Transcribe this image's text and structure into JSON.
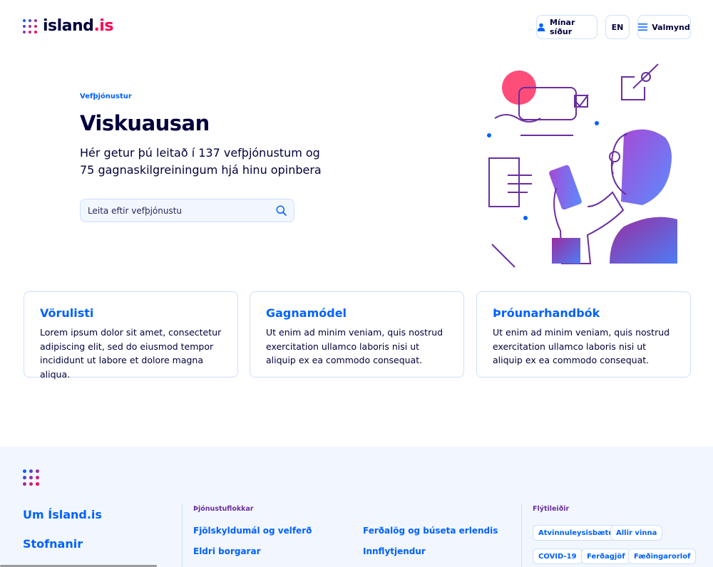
{
  "header": {
    "logo_text": "island",
    "logo_suffix": ".is",
    "my_pages_label": "Mínar síður",
    "lang_label": "EN",
    "menu_label": "Valmynd"
  },
  "hero": {
    "eyebrow": "Vefþjónustur",
    "title": "Viskuausan",
    "intro": "Hér getur þú leitað í 137 vefþjónustum og 75 gagnaskilgreiningum hjá hinu opinbera",
    "search_placeholder": "Leita eftir vefþjónustu"
  },
  "cards": [
    {
      "title": "Vörulisti",
      "text": "Lorem ipsum dolor sit amet, consectetur adipiscing elit, sed do eiusmod tempor incididunt ut labore et dolore magna aliqua."
    },
    {
      "title": "Gagnamódel",
      "text": "Ut enim ad minim veniam, quis nostrud exercitation ullamco laboris nisi ut aliquip ex ea commodo consequat."
    },
    {
      "title": "Þróunarhandbók",
      "text": "Ut enim ad minim veniam, quis nostrud exercitation ullamco laboris nisi ut aliquip ex ea commodo consequat."
    }
  ],
  "footer": {
    "main_links": [
      "Um Ísland.is",
      "Stofnanir"
    ],
    "categories_heading": "Þjónustuflokkar",
    "categories": [
      "Fjölskyldumál og velferð",
      "Ferðalög og búseta erlendis",
      "Eldri borgarar",
      "Innflytjendur"
    ],
    "shortcuts_heading": "Flýtileiðir",
    "shortcuts": [
      "Atvinnuleysisbætur",
      "Allir vinna",
      "COVID-19",
      "Ferðagjöf",
      "Fæðingarorlof"
    ]
  },
  "colors": {
    "primary": "#0061ff",
    "dark": "#00003c",
    "accent_pink": "#ff0050",
    "purple": "#6a2ea0",
    "border": "#ccdfff",
    "footer_bg": "#f2f7ff"
  },
  "icons": [
    "user-icon",
    "menu-icon",
    "search-icon"
  ]
}
